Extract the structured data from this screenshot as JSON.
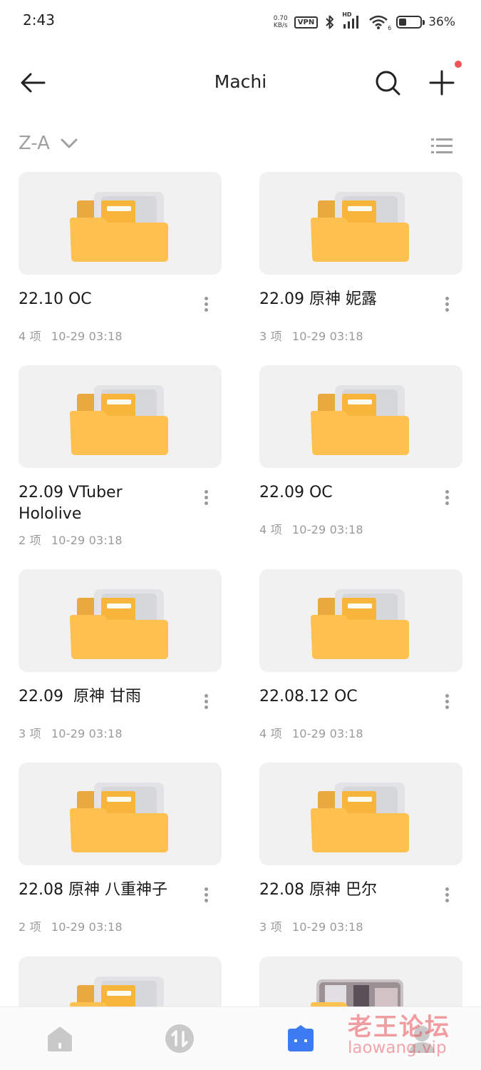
{
  "status_bar": {
    "time": "2:43",
    "net_speed_value": "0.70",
    "net_speed_unit": "KB/s",
    "vpn": "VPN",
    "signal_label": "HD",
    "wifi_label": "6",
    "battery_percent": "36%",
    "battery_level": 0.36
  },
  "app_bar": {
    "title": "Machi",
    "has_notification": true
  },
  "sort": {
    "label": "Z-A"
  },
  "folders": [
    {
      "name": "22.10 OC",
      "count": "4 项",
      "date": "10-29 03:18"
    },
    {
      "name": "22.09 原神 妮露",
      "count": "3 项",
      "date": "10-29 03:18"
    },
    {
      "name": "22.09 VTuber Hololive",
      "count": "2 项",
      "date": "10-29 03:18"
    },
    {
      "name": "22.09 OC",
      "count": "4 项",
      "date": "10-29 03:18"
    },
    {
      "name": "22.09  原神 甘雨",
      "count": "3 项",
      "date": "10-29 03:18"
    },
    {
      "name": "22.08.12 OC",
      "count": "4 项",
      "date": "10-29 03:18"
    },
    {
      "name": "22.08 原神 八重神子",
      "count": "2 项",
      "date": "10-29 03:18"
    },
    {
      "name": "22.08 原神 巴尔",
      "count": "3 项",
      "date": "10-29 03:18"
    }
  ],
  "bottom_nav": {
    "items": [
      {
        "icon": "home-icon",
        "active": false
      },
      {
        "icon": "transfer-icon",
        "active": false
      },
      {
        "icon": "files-icon",
        "active": true
      },
      {
        "icon": "profile-icon",
        "active": false
      }
    ]
  },
  "watermark": {
    "main": "老王论坛",
    "sub": "laowang.vip"
  },
  "colors": {
    "folder_front": "#fec04f",
    "folder_back": "#eaa93f",
    "active_nav": "#3d7bf2",
    "inactive_nav": "#c9c9c9",
    "notification": "#f05454"
  }
}
